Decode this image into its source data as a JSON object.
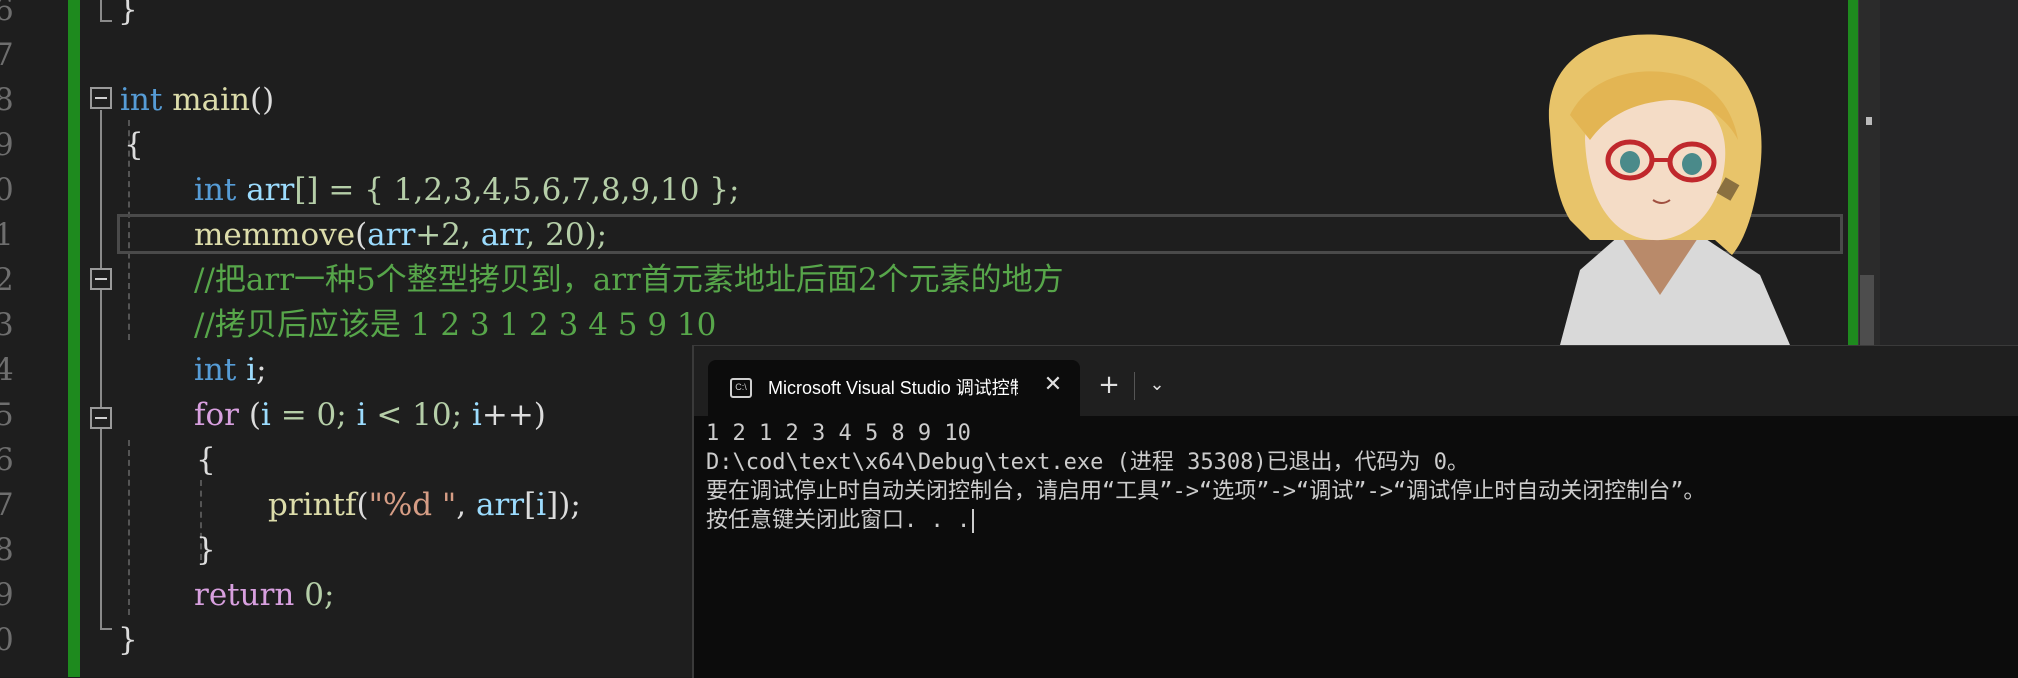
{
  "editor": {
    "line_numbers": [
      "6",
      "7",
      "8",
      "9",
      "0",
      "1",
      "2",
      "3",
      "4",
      "5",
      "6",
      "7",
      "8",
      "9",
      "0"
    ],
    "lines": {
      "l1": "}",
      "l3_kw": "int",
      "l3_fn": "main",
      "l3_rest": "()",
      "l4": "{",
      "l5_kw": "int",
      "l5_var": "arr",
      "l5_rest": "[] = { 1,2,3,4,5,6,7,8,9,10 };",
      "l6_fn": "memmove",
      "l6_p1": "(",
      "l6_var1": "arr",
      "l6_p2": "+2, ",
      "l6_var2": "arr",
      "l6_p3": ", 20);",
      "l7": "//把arr一种5个整型拷贝到，arr首元素地址后面2个元素的地方",
      "l8": "//拷贝后应该是 1 2 3 1 2 3 4 5 9 10",
      "l9_kw": "int",
      "l9_var": "i",
      "l9_rest": ";",
      "l10_kw": "for",
      "l10_a": " (",
      "l10_i1": "i",
      "l10_b": " = 0; ",
      "l10_i2": "i",
      "l10_c": " < 10; ",
      "l10_i3": "i",
      "l10_d": "++)",
      "l11": "{",
      "l12_fn": "printf",
      "l12_a": "(",
      "l12_str": "\"%d \"",
      "l12_b": ", ",
      "l12_var": "arr",
      "l12_c": "[",
      "l12_i": "i",
      "l12_d": "]);",
      "l13": "}",
      "l14_kw": "return",
      "l14_rest": " 0;",
      "l15": "}"
    }
  },
  "console": {
    "tab_title": "Microsoft Visual Studio 调试控制台",
    "tab_icon": "C:\\",
    "close_glyph": "✕",
    "add_glyph": "+",
    "dropdown_glyph": "⌄",
    "output": [
      "1 2 1 2 3 4 5 8 9 10",
      "D:\\cod\\text\\x64\\Debug\\text.exe (进程 35308)已退出，代码为 0。",
      "要在调试停止时自动关闭控制台，请启用“工具”->“选项”->“调试”->“调试停止时自动关闭控制台”。",
      "按任意键关闭此窗口. . ."
    ]
  },
  "colors": {
    "keyword": "#569cd6",
    "function": "#dcdcaa",
    "variable": "#9cdcfe",
    "comment": "#57a64a",
    "change_bar": "#1e8a1e"
  }
}
